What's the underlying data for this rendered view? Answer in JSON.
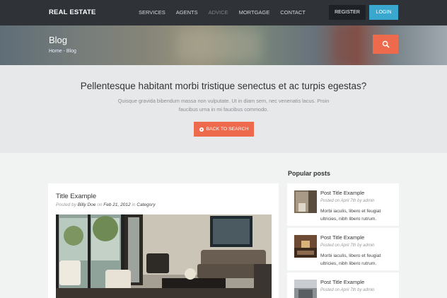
{
  "header": {
    "logo": "REAL ESTATE",
    "nav": [
      "SERVICES",
      "AGENTS",
      "ADVICE",
      "MORTGAGE",
      "CONTACT"
    ],
    "active_nav": "ADVICE",
    "register_label": "REGISTER",
    "login_label": "LOGIN"
  },
  "hero": {
    "title": "Blog",
    "breadcrumb": "Home - Blog",
    "search_icon": "search-icon"
  },
  "intro": {
    "title": "Pellentesque habitant morbi tristique senectus et ac turpis egestas?",
    "text_line1": "Quisque gravida bibendum massa non vulputate. Ut in diam sem, nec venenatis lacus. Proin",
    "text_line2": "faucibus urna in mi faucibus commodo.",
    "back_button": "BACK TO SEARCH"
  },
  "post": {
    "title": "Title Example",
    "posted_by": "Posted by",
    "author": "Billy Doe",
    "on": "on",
    "date": "Feb 21, 2012",
    "in": "in",
    "category": "Category"
  },
  "sidebar": {
    "heading": "Popular posts",
    "items": [
      {
        "title": "Post Title Example",
        "meta": "Posted on April 7th by admin",
        "excerpt": "Morbi iaculis, libero et feugiat ultricies, nibh libero rutrum."
      },
      {
        "title": "Post Title Example",
        "meta": "Posted on April 7th by admin",
        "excerpt": "Morbi iaculis, libero et feugiat ultricies, nibh libero rutrum."
      },
      {
        "title": "Post Title Example",
        "meta": "Posted on April 7th by admin",
        "excerpt": ""
      }
    ]
  },
  "colors": {
    "topbar": "#2f3338",
    "accent_orange": "#ee6a4c",
    "login_blue": "#3aa7cf"
  }
}
